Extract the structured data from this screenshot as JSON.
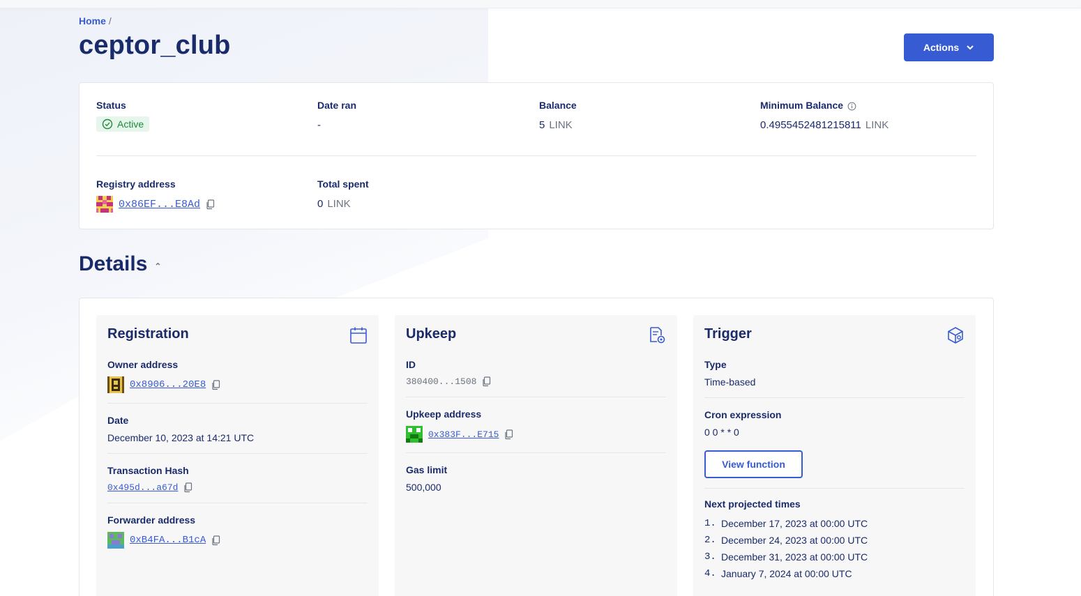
{
  "breadcrumb": {
    "home": "Home",
    "separator": "/"
  },
  "page": {
    "title": "ceptor_club"
  },
  "header": {
    "actions_label": "Actions"
  },
  "summary": {
    "status": {
      "label": "Status",
      "value": "Active"
    },
    "date_ran": {
      "label": "Date ran",
      "value": "-"
    },
    "balance": {
      "label": "Balance",
      "amount": "5",
      "unit": "LINK"
    },
    "min_balance": {
      "label": "Minimum Balance",
      "amount": "0.4955452481215811",
      "unit": "LINK"
    },
    "registry": {
      "label": "Registry address",
      "address": "0x86EF...E8Ad"
    },
    "total_spent": {
      "label": "Total spent",
      "amount": "0",
      "unit": "LINK"
    }
  },
  "details": {
    "title": "Details",
    "registration": {
      "title": "Registration",
      "owner_label": "Owner address",
      "owner_address": "0x8906...20E8",
      "date_label": "Date",
      "date_value": "December 10, 2023 at 14:21 UTC",
      "tx_label": "Transaction Hash",
      "tx_value": "0x495d...a67d",
      "forwarder_label": "Forwarder address",
      "forwarder_address": "0xB4FA...B1cA"
    },
    "upkeep": {
      "title": "Upkeep",
      "id_label": "ID",
      "id_value": "380400...1508",
      "address_label": "Upkeep address",
      "address_value": "0x383F...E715",
      "gas_label": "Gas limit",
      "gas_value": "500,000"
    },
    "trigger": {
      "title": "Trigger",
      "type_label": "Type",
      "type_value": "Time-based",
      "cron_label": "Cron expression",
      "cron_value": "0 0 * * 0",
      "view_function": "View function",
      "next_label": "Next projected times",
      "times": [
        {
          "num": "1.",
          "text": "December 17, 2023 at 00:00 UTC"
        },
        {
          "num": "2.",
          "text": "December 24, 2023 at 00:00 UTC"
        },
        {
          "num": "3.",
          "text": "December 31, 2023 at 00:00 UTC"
        },
        {
          "num": "4.",
          "text": "January 7, 2024 at 00:00 UTC"
        }
      ]
    }
  },
  "colors": {
    "accent": "#375bd2",
    "title": "#1a2b6b",
    "success": "#1d8a3a",
    "muted": "#6b7280"
  }
}
